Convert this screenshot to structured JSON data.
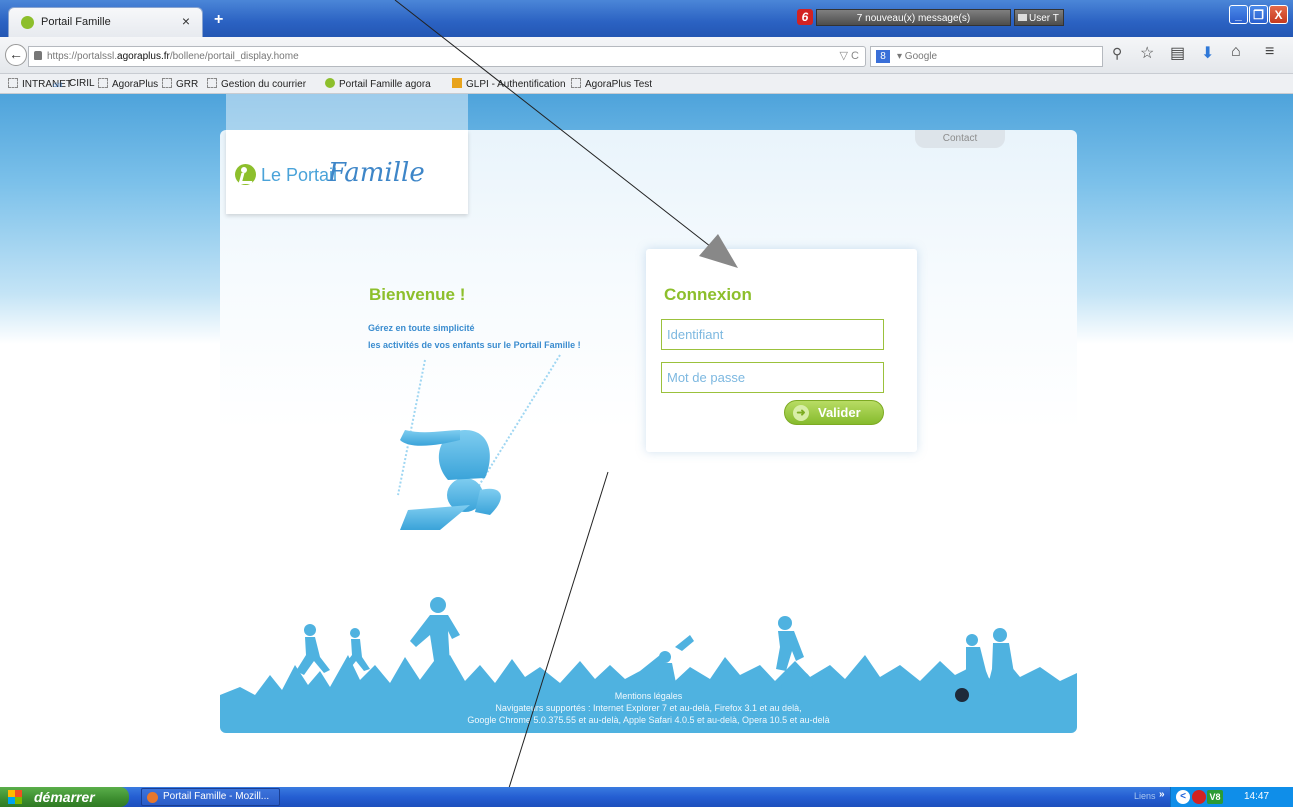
{
  "browser": {
    "tab_label": "Portail Famille",
    "tab_close": "×",
    "new_tab": "+",
    "notification": "7 nouveau(x) message(s)",
    "notification_icon": "6",
    "user_box": "User T",
    "window_controls": {
      "minimize": "_",
      "maximize": "❐",
      "close": "X"
    }
  },
  "navbar": {
    "back": "←",
    "url_prefix": "https://portalssl.",
    "url_domain": "agoraplus.fr",
    "url_path": "/bollene/portail_display.home",
    "url_tools": "▽ C",
    "search_engine": "8",
    "search_placeholder": "▾ Google",
    "search_icon": "⚲",
    "icons": [
      "star-icon",
      "reading-list-icon",
      "download-icon",
      "home-icon",
      "menu-icon"
    ],
    "icon_glyphs": {
      "star": "☆",
      "reading": "▤",
      "download": "⬇",
      "home": "⌂",
      "menu": "≡"
    }
  },
  "bookmarks": [
    {
      "label": "INTRANET",
      "icon": "folder"
    },
    {
      "label": "CIRIL",
      "icon": "ciril"
    },
    {
      "label": "AgoraPlus",
      "icon": "folder"
    },
    {
      "label": "GRR",
      "icon": "folder"
    },
    {
      "label": "Gestion du courrier",
      "icon": "folder"
    },
    {
      "label": "Portail Famille agora",
      "icon": "portail"
    },
    {
      "label": "GLPI - Authentification",
      "icon": "glpi"
    },
    {
      "label": "AgoraPlus Test",
      "icon": "folder"
    }
  ],
  "page": {
    "contact": "Contact",
    "logo_text_1": "Le Portail",
    "logo_text_2": "Famille",
    "welcome_title": "Bienvenue !",
    "welcome_line_1": "Gérez en toute simplicité",
    "welcome_line_2": "les activités de vos enfants sur le Portail Famille !",
    "login_title": "Connexion",
    "login_id_placeholder": "Identifiant",
    "login_pw_placeholder": "Mot de passe",
    "submit_label": "Valider",
    "footer_mentions": "Mentions légales",
    "footer_nav_1": "Navigateurs supportés : Internet Explorer 7 et au-delà, Firefox 3.1 et au delà,",
    "footer_nav_2": "Google Chrome 5.0.375.55 et au-delà, Apple Safari 4.0.5 et au-delà, Opera 10.5 et au-delà"
  },
  "taskbar": {
    "start": "démarrer",
    "task_item": "Portail Famille - Mozill...",
    "liens": "Liens",
    "liens_chevron": "»",
    "tray_v": "V8",
    "clock": "14:47"
  },
  "colors": {
    "accent_green": "#8dbf2c",
    "accent_blue": "#3a8ccf",
    "silhouette_blue": "#4fb2e0"
  }
}
